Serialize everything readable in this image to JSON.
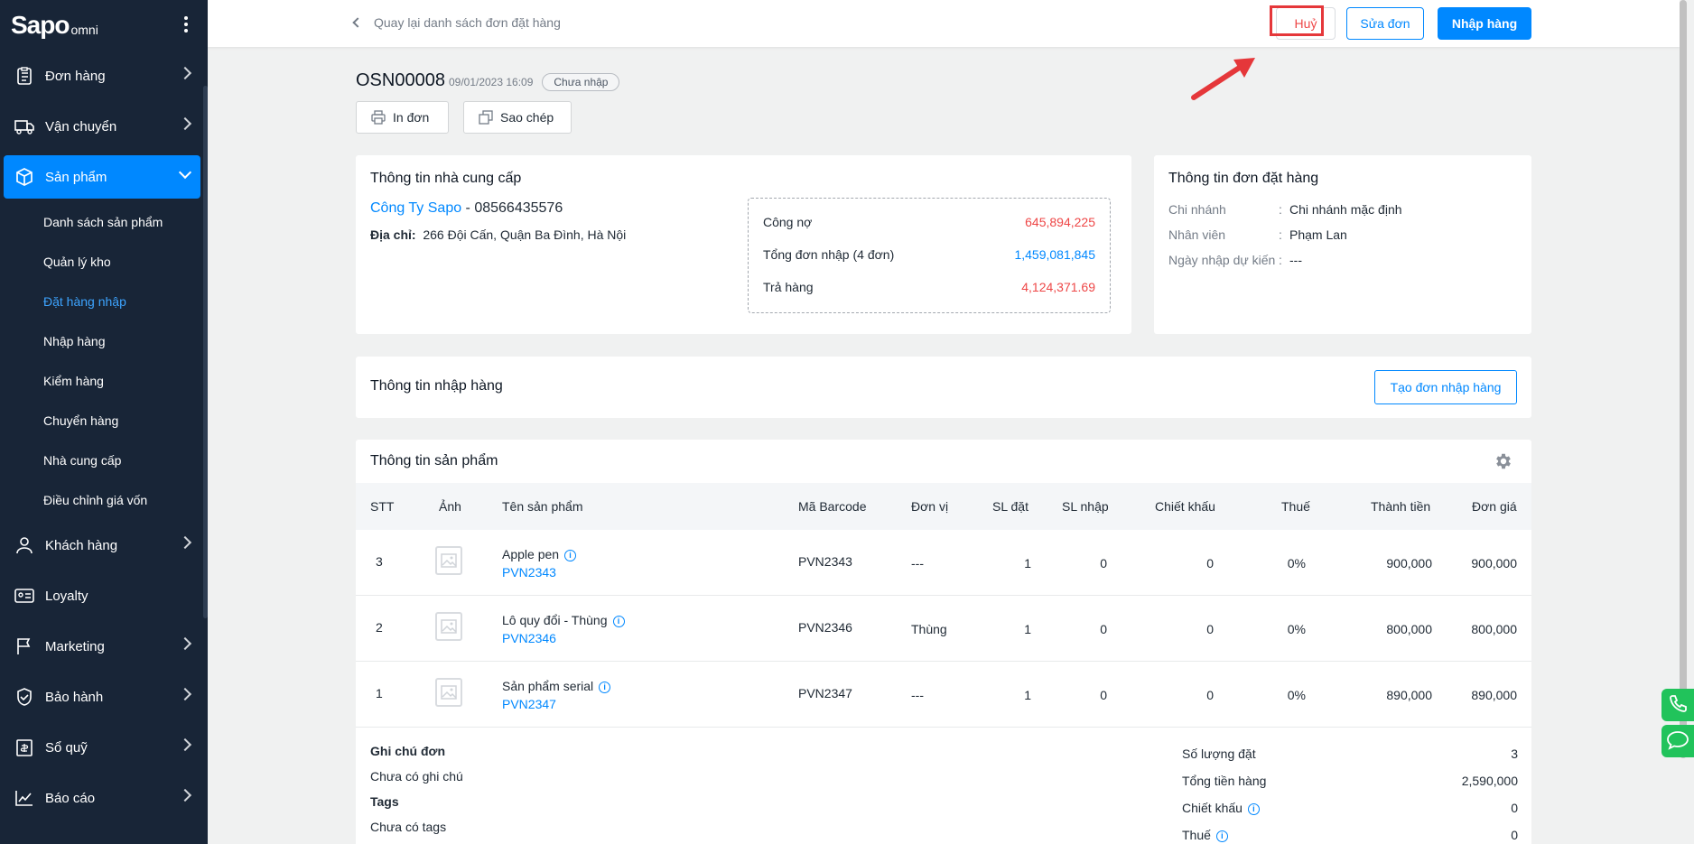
{
  "sidebar": {
    "logo": "Sapo",
    "logo_sub": "omni",
    "items": [
      {
        "label": "Đơn hàng"
      },
      {
        "label": "Vận chuyển"
      },
      {
        "label": "Sản phẩm"
      },
      {
        "label": "Khách hàng"
      },
      {
        "label": "Loyalty"
      },
      {
        "label": "Marketing"
      },
      {
        "label": "Bảo hành"
      },
      {
        "label": "Sổ quỹ"
      },
      {
        "label": "Báo cáo"
      }
    ],
    "subitems": [
      {
        "label": "Danh sách sản phẩm"
      },
      {
        "label": "Quản lý kho"
      },
      {
        "label": "Đặt hàng nhập"
      },
      {
        "label": "Nhập hàng"
      },
      {
        "label": "Kiểm hàng"
      },
      {
        "label": "Chuyển hàng"
      },
      {
        "label": "Nhà cung cấp"
      },
      {
        "label": "Điều chỉnh giá vốn"
      }
    ]
  },
  "topbar": {
    "back_label": "Quay lại danh sách đơn đặt hàng",
    "cancel_label": "Huỷ",
    "edit_label": "Sửa đơn",
    "import_label": "Nhập hàng"
  },
  "order": {
    "code": "OSN00008",
    "date": "09/01/2023 16:09",
    "status": "Chưa nhập",
    "print_label": "In đơn",
    "copy_label": "Sao chép"
  },
  "supplier": {
    "title": "Thông tin nhà cung cấp",
    "name": "Công Ty Sapo",
    "separator": " - ",
    "phone": "08566435576",
    "address_label": "Địa chỉ:",
    "address": "266 Đội Cấn, Quận Ba Đình, Hà Nội",
    "debt_label": "Công nợ",
    "debt_value": "645,894,225",
    "total_label": "Tổng đơn nhập (4 đơn)",
    "total_value": "1,459,081,845",
    "return_label": "Trả hàng",
    "return_value": "4,124,371.69"
  },
  "order_info": {
    "title": "Thông tin đơn đặt hàng",
    "branch_label": "Chi nhánh",
    "branch_value": "Chi nhánh mặc định",
    "staff_label": "Nhân viên",
    "staff_value": "Phạm Lan",
    "date_label": "Ngày nhập dự kiến",
    "date_value": "---",
    "colon": ":"
  },
  "import_info": {
    "title": "Thông tin nhập hàng",
    "create_label": "Tạo đơn nhập hàng"
  },
  "products": {
    "title": "Thông tin sản phẩm",
    "columns": {
      "stt": "STT",
      "image": "Ảnh",
      "name": "Tên sản phẩm",
      "barcode": "Mã Barcode",
      "unit": "Đơn vị",
      "qty_order": "SL đặt",
      "qty_import": "SL nhập",
      "discount": "Chiết khấu",
      "tax": "Thuế",
      "total": "Thành tiền",
      "price": "Đơn giá"
    },
    "rows": [
      {
        "stt": "3",
        "name": "Apple pen",
        "code": "PVN2343",
        "barcode": "PVN2343",
        "unit": "---",
        "qty_order": "1",
        "qty_import": "0",
        "discount": "0",
        "tax": "0%",
        "total": "900,000",
        "price": "900,000"
      },
      {
        "stt": "2",
        "name": "Lô quy đổi - Thùng",
        "code": "PVN2346",
        "barcode": "PVN2346",
        "unit": "Thùng",
        "qty_order": "1",
        "qty_import": "0",
        "discount": "0",
        "tax": "0%",
        "total": "800,000",
        "price": "800,000"
      },
      {
        "stt": "1",
        "name": "Sản phẩm serial",
        "code": "PVN2347",
        "barcode": "PVN2347",
        "unit": "---",
        "qty_order": "1",
        "qty_import": "0",
        "discount": "0",
        "tax": "0%",
        "total": "890,000",
        "price": "890,000"
      }
    ]
  },
  "notes": {
    "note_title": "Ghi chú đơn",
    "note_value": "Chưa có ghi chú",
    "tags_title": "Tags",
    "tags_value": "Chưa có tags"
  },
  "summary": {
    "qty_label": "Số lượng đặt",
    "qty_value": "3",
    "goods_label": "Tổng tiền hàng",
    "goods_value": "2,590,000",
    "discount_label": "Chiết khấu",
    "discount_value": "0",
    "tax_label": "Thuế",
    "tax_value": "0"
  },
  "colors": {
    "accent": "#0088FF",
    "sidebar_bg": "#182537",
    "danger": "#EE4747",
    "annotation": "#E5373A"
  },
  "icons": [
    "kebab-icon",
    "orders-icon",
    "shipping-icon",
    "product-box-icon",
    "customer-icon",
    "loyalty-icon",
    "marketing-flag-icon",
    "warranty-shield-icon",
    "cashbook-icon",
    "report-chart-icon",
    "chevron-left-icon",
    "printer-icon",
    "copy-icon",
    "gear-icon",
    "info-icon",
    "image-placeholder-icon",
    "phone-icon",
    "chat-icon",
    "arrow-annotation-icon"
  ]
}
